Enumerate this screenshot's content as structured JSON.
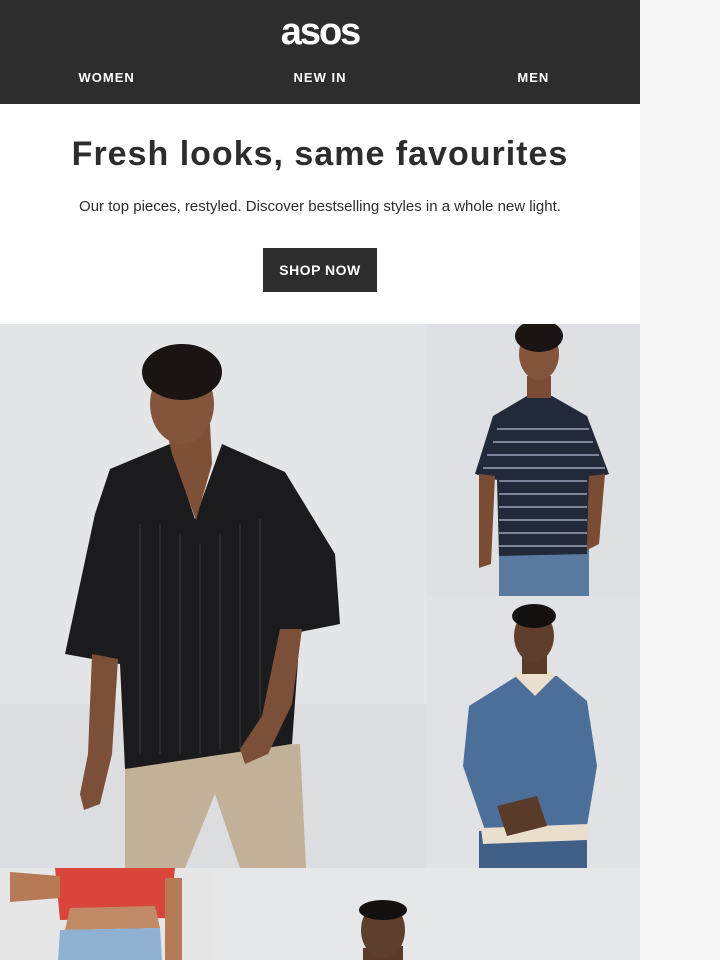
{
  "brand": {
    "logo_text": "asos"
  },
  "nav": {
    "items": [
      {
        "label": "WOMEN"
      },
      {
        "label": "NEW IN"
      },
      {
        "label": "MEN"
      }
    ]
  },
  "hero": {
    "title": "Fresh looks, same favourites",
    "subtitle": "Our top pieces, restyled. Discover bestselling styles in a whole new light.",
    "cta_label": "SHOP NOW"
  },
  "colors": {
    "header_bg": "#2d2d2d",
    "text": "#2d2d2d",
    "cta_bg": "#2d2d2d"
  }
}
